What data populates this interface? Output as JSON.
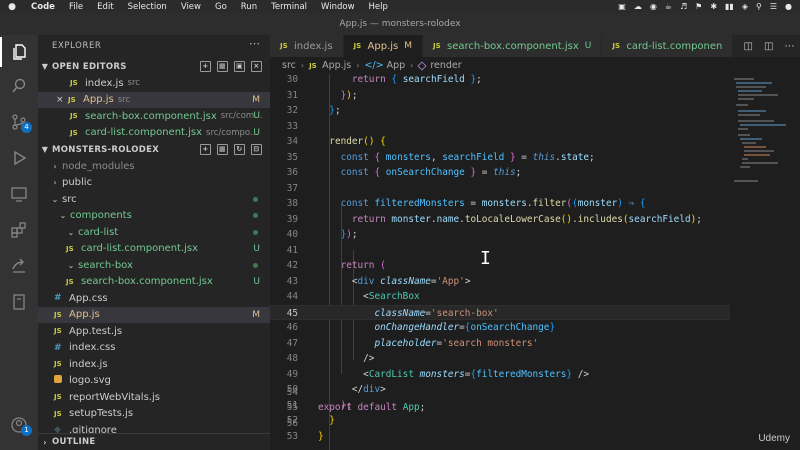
{
  "menubar": {
    "app": "Code",
    "items": [
      "File",
      "Edit",
      "Selection",
      "View",
      "Go",
      "Run",
      "Terminal",
      "Window",
      "Help"
    ]
  },
  "window": {
    "title": "App.js — monsters-rolodex"
  },
  "activity_bar": {
    "scm_badge": "4",
    "accounts_badge": "1"
  },
  "sidebar": {
    "title": "EXPLORER",
    "open_editors": {
      "label": "OPEN EDITORS",
      "items": [
        {
          "name": "index.js",
          "dir": "src",
          "status": ""
        },
        {
          "name": "App.js",
          "dir": "src",
          "status": "M"
        },
        {
          "name": "search-box.component.jsx",
          "dir": "src/com...",
          "status": "U"
        },
        {
          "name": "card-list.component.jsx",
          "dir": "src/compo...",
          "status": "U"
        }
      ]
    },
    "project": {
      "label": "MONSTERS-ROLODEX",
      "tree": [
        {
          "name": "node_modules",
          "status": ""
        },
        {
          "name": "public",
          "status": ""
        },
        {
          "name": "src",
          "status": ""
        },
        {
          "name": "components",
          "status": ""
        },
        {
          "name": "card-list",
          "status": ""
        },
        {
          "name": "card-list.component.jsx",
          "status": "U"
        },
        {
          "name": "search-box",
          "status": ""
        },
        {
          "name": "search-box.component.jsx",
          "status": "U"
        },
        {
          "name": "App.css",
          "status": ""
        },
        {
          "name": "App.js",
          "status": "M"
        },
        {
          "name": "App.test.js",
          "status": ""
        },
        {
          "name": "index.css",
          "status": ""
        },
        {
          "name": "index.js",
          "status": ""
        },
        {
          "name": "logo.svg",
          "status": ""
        },
        {
          "name": "reportWebVitals.js",
          "status": ""
        },
        {
          "name": "setupTests.js",
          "status": ""
        },
        {
          "name": ".gitignore",
          "status": ""
        }
      ]
    },
    "outline_label": "OUTLINE"
  },
  "tabs": [
    {
      "label": "index.js",
      "status": ""
    },
    {
      "label": "App.js",
      "status": "M"
    },
    {
      "label": "search-box.component.jsx",
      "status": "U"
    },
    {
      "label": "card-list.componen",
      "status": ""
    }
  ],
  "breadcrumb": {
    "folder": "src",
    "file": "App.js",
    "symbol": "App",
    "method": "render"
  },
  "editor": {
    "line_numbers": [
      "30",
      "31",
      "32",
      "33",
      "34",
      "35",
      "36",
      "37",
      "38",
      "39",
      "40",
      "41",
      "42",
      "43",
      "44",
      "45",
      "46",
      "47",
      "48",
      "49",
      "50",
      "51",
      "52",
      "53",
      "54",
      "55",
      "56"
    ]
  },
  "watermark": "Udemy"
}
